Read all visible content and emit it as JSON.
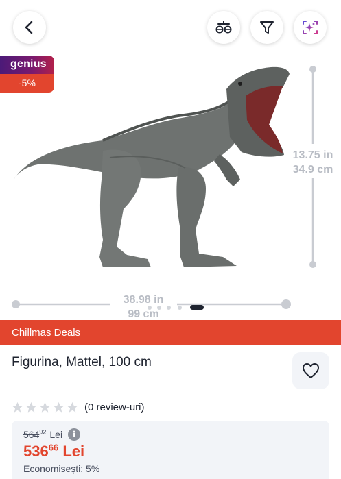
{
  "topbar": {
    "back": {
      "icon": "chevron-left-icon"
    },
    "compare": {
      "icon": "compare-icon"
    },
    "filter": {
      "icon": "filter-icon"
    },
    "ai": {
      "icon": "ai-sparkle-icon"
    }
  },
  "badge": {
    "brand": "genius",
    "discount": "-5%"
  },
  "gallery": {
    "height_text": [
      "13.75 in",
      "34.9 cm"
    ],
    "width_text": [
      "38.98 in",
      "99 cm"
    ],
    "dots_total": 5,
    "active_dot": 4
  },
  "promo": {
    "label": "Chillmas Deals"
  },
  "product": {
    "title": "Figurina, Mattel, 100 cm"
  },
  "rating": {
    "stars": 0,
    "max": 5,
    "count_text": "(0 review-uri)"
  },
  "price": {
    "old_int": "564",
    "old_dec": "92",
    "old_currency": "Lei",
    "new_int": "536",
    "new_dec": "66",
    "new_currency": "Lei",
    "savings_text": "Economisești: 5%"
  },
  "colors": {
    "accent": "#e2452e",
    "genius_purple": "#4b1a78",
    "card_bg": "#f2f4f8",
    "star_empty": "#d6d9de"
  }
}
